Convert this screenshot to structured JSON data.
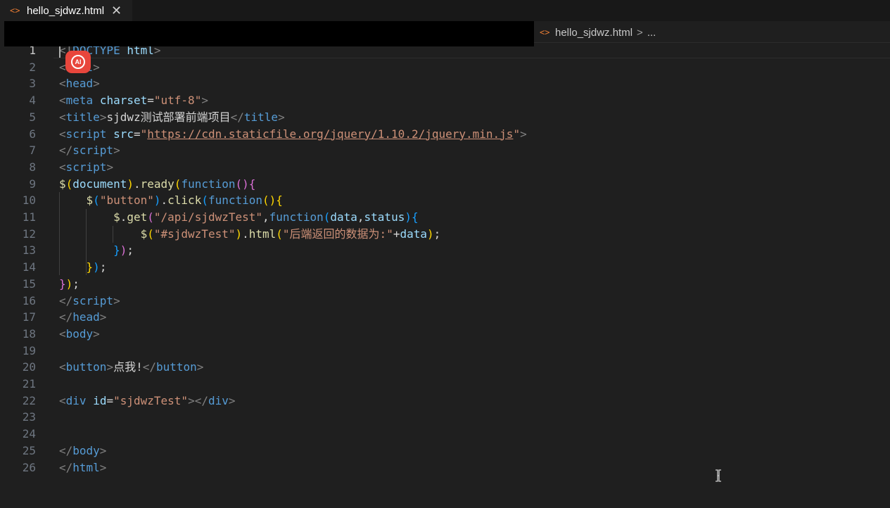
{
  "tab": {
    "icon": "html-brackets-icon",
    "glyph": "<>",
    "label": "hello_sjdwz.html",
    "close": "✕"
  },
  "breadcrumb": {
    "glyph": "<>",
    "file": "hello_sjdwz.html",
    "sep": ">",
    "more": "..."
  },
  "ai_badge": {
    "label": "AI"
  },
  "editor": {
    "active_line": 1,
    "lines": [
      {
        "n": "1",
        "tokens": [
          [
            "punct",
            "<!"
          ],
          [
            "tag",
            "DOCTYPE"
          ],
          [
            "text",
            " "
          ],
          [
            "attr",
            "html"
          ],
          [
            "punct",
            ">"
          ]
        ]
      },
      {
        "n": "2",
        "tokens": [
          [
            "punct",
            "<"
          ],
          [
            "tag",
            "html"
          ],
          [
            "punct",
            ">"
          ]
        ]
      },
      {
        "n": "3",
        "tokens": [
          [
            "punct",
            "<"
          ],
          [
            "tag",
            "head"
          ],
          [
            "punct",
            ">"
          ]
        ]
      },
      {
        "n": "4",
        "tokens": [
          [
            "punct",
            "<"
          ],
          [
            "tag",
            "meta"
          ],
          [
            "text",
            " "
          ],
          [
            "attr",
            "charset"
          ],
          [
            "text",
            "="
          ],
          [
            "str",
            "\"utf-8\""
          ],
          [
            "punct",
            ">"
          ]
        ]
      },
      {
        "n": "5",
        "tokens": [
          [
            "punct",
            "<"
          ],
          [
            "tag",
            "title"
          ],
          [
            "punct",
            ">"
          ],
          [
            "text",
            "sjdwz测试部署前端项目"
          ],
          [
            "punct",
            "</"
          ],
          [
            "tag",
            "title"
          ],
          [
            "punct",
            ">"
          ]
        ]
      },
      {
        "n": "6",
        "tokens": [
          [
            "punct",
            "<"
          ],
          [
            "tag",
            "script"
          ],
          [
            "text",
            " "
          ],
          [
            "attr",
            "src"
          ],
          [
            "text",
            "="
          ],
          [
            "str",
            "\""
          ],
          [
            "url",
            "https://cdn.staticfile.org/jquery/1.10.2/jquery.min.js"
          ],
          [
            "str",
            "\""
          ],
          [
            "punct",
            ">"
          ]
        ]
      },
      {
        "n": "7",
        "tokens": [
          [
            "punct",
            "</"
          ],
          [
            "tag",
            "script"
          ],
          [
            "punct",
            ">"
          ]
        ]
      },
      {
        "n": "8",
        "tokens": [
          [
            "punct",
            "<"
          ],
          [
            "tag",
            "script"
          ],
          [
            "punct",
            ">"
          ]
        ]
      },
      {
        "n": "9",
        "tokens": [
          [
            "fn",
            "$"
          ],
          [
            "b1",
            "("
          ],
          [
            "var",
            "document"
          ],
          [
            "b1",
            ")"
          ],
          [
            "text",
            "."
          ],
          [
            "fn",
            "ready"
          ],
          [
            "b1",
            "("
          ],
          [
            "kw",
            "function"
          ],
          [
            "b2",
            "()"
          ],
          [
            "b2",
            "{"
          ]
        ]
      },
      {
        "n": "10",
        "tokens": [
          [
            "text",
            "    "
          ],
          [
            "fn",
            "$"
          ],
          [
            "b3",
            "("
          ],
          [
            "str",
            "\"button\""
          ],
          [
            "b3",
            ")"
          ],
          [
            "text",
            "."
          ],
          [
            "fn",
            "click"
          ],
          [
            "b3",
            "("
          ],
          [
            "kw",
            "function"
          ],
          [
            "b1",
            "()"
          ],
          [
            "b1",
            "{"
          ]
        ]
      },
      {
        "n": "11",
        "tokens": [
          [
            "text",
            "        "
          ],
          [
            "fn",
            "$"
          ],
          [
            "text",
            "."
          ],
          [
            "fn",
            "get"
          ],
          [
            "b2",
            "("
          ],
          [
            "str",
            "\"/api/sjdwzTest\""
          ],
          [
            "text",
            ","
          ],
          [
            "kw",
            "function"
          ],
          [
            "b3",
            "("
          ],
          [
            "var",
            "data"
          ],
          [
            "text",
            ","
          ],
          [
            "var",
            "status"
          ],
          [
            "b3",
            ")"
          ],
          [
            "b3",
            "{"
          ]
        ]
      },
      {
        "n": "12",
        "tokens": [
          [
            "text",
            "            "
          ],
          [
            "fn",
            "$"
          ],
          [
            "b1",
            "("
          ],
          [
            "str",
            "\"#sjdwzTest\""
          ],
          [
            "b1",
            ")"
          ],
          [
            "text",
            "."
          ],
          [
            "fn",
            "html"
          ],
          [
            "b1",
            "("
          ],
          [
            "str",
            "\"后端返回的数据为:\""
          ],
          [
            "text",
            "+"
          ],
          [
            "var",
            "data"
          ],
          [
            "b1",
            ")"
          ],
          [
            "text",
            ";"
          ]
        ]
      },
      {
        "n": "13",
        "tokens": [
          [
            "text",
            "        "
          ],
          [
            "b3",
            "}"
          ],
          [
            "b2",
            ")"
          ],
          [
            "text",
            ";"
          ]
        ]
      },
      {
        "n": "14",
        "tokens": [
          [
            "text",
            "    "
          ],
          [
            "b1",
            "}"
          ],
          [
            "b3",
            ")"
          ],
          [
            "text",
            ";"
          ]
        ]
      },
      {
        "n": "15",
        "tokens": [
          [
            "b2",
            "}"
          ],
          [
            "b1",
            ")"
          ],
          [
            "text",
            ";"
          ]
        ]
      },
      {
        "n": "16",
        "tokens": [
          [
            "punct",
            "</"
          ],
          [
            "tag",
            "script"
          ],
          [
            "punct",
            ">"
          ]
        ]
      },
      {
        "n": "17",
        "tokens": [
          [
            "punct",
            "</"
          ],
          [
            "tag",
            "head"
          ],
          [
            "punct",
            ">"
          ]
        ]
      },
      {
        "n": "18",
        "tokens": [
          [
            "punct",
            "<"
          ],
          [
            "tag",
            "body"
          ],
          [
            "punct",
            ">"
          ]
        ]
      },
      {
        "n": "19",
        "tokens": []
      },
      {
        "n": "20",
        "tokens": [
          [
            "punct",
            "<"
          ],
          [
            "tag",
            "button"
          ],
          [
            "punct",
            ">"
          ],
          [
            "text",
            "点我!"
          ],
          [
            "punct",
            "</"
          ],
          [
            "tag",
            "button"
          ],
          [
            "punct",
            ">"
          ]
        ]
      },
      {
        "n": "21",
        "tokens": []
      },
      {
        "n": "22",
        "tokens": [
          [
            "punct",
            "<"
          ],
          [
            "tag",
            "div"
          ],
          [
            "text",
            " "
          ],
          [
            "attr",
            "id"
          ],
          [
            "text",
            "="
          ],
          [
            "str",
            "\"sjdwzTest\""
          ],
          [
            "punct",
            "></"
          ],
          [
            "tag",
            "div"
          ],
          [
            "punct",
            ">"
          ]
        ]
      },
      {
        "n": "23",
        "tokens": []
      },
      {
        "n": "24",
        "tokens": []
      },
      {
        "n": "25",
        "tokens": [
          [
            "punct",
            "</"
          ],
          [
            "tag",
            "body"
          ],
          [
            "punct",
            ">"
          ]
        ]
      },
      {
        "n": "26",
        "tokens": [
          [
            "punct",
            "</"
          ],
          [
            "tag",
            "html"
          ],
          [
            "punct",
            ">"
          ]
        ]
      }
    ]
  }
}
